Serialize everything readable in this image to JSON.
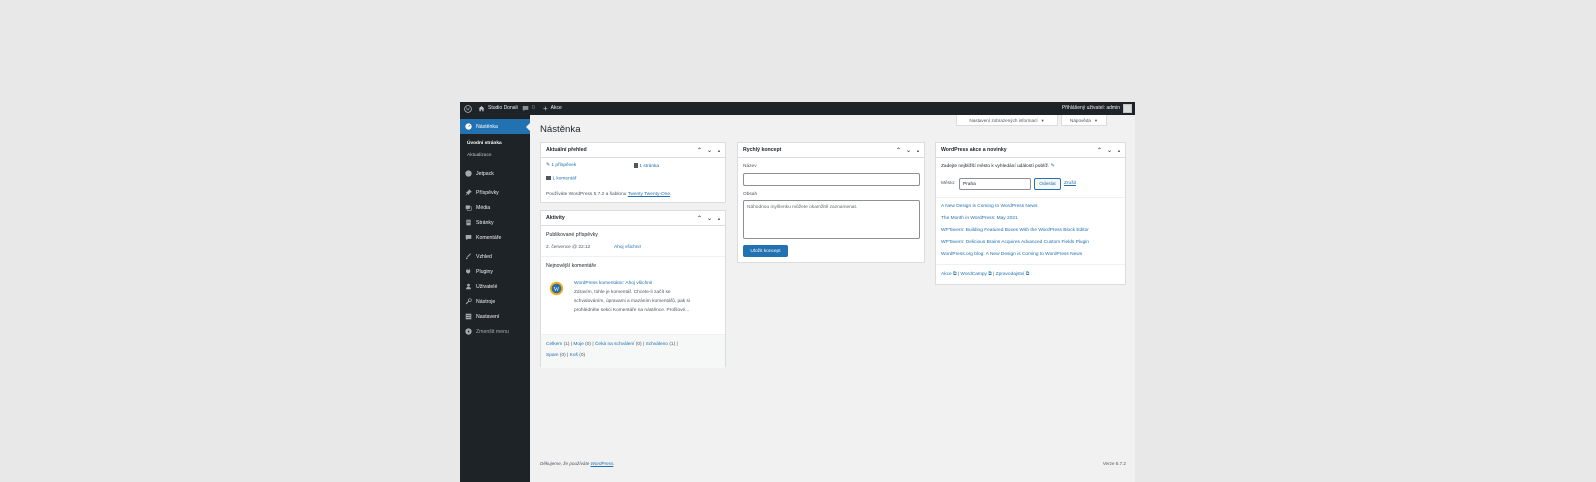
{
  "adminbar": {
    "site_name": "Studio Donali",
    "comments_count": "0",
    "new_label": "Akce",
    "user_greeting": "Přihlášený uživatel: admin"
  },
  "sidebar": {
    "dashboard": "Nástěnka",
    "sub_home": "Úvodní stránka",
    "sub_updates": "Aktualizace",
    "jetpack": "Jetpack",
    "posts": "Příspěvky",
    "media": "Média",
    "pages": "Stránky",
    "comments": "Komentáře",
    "appearance": "Vzhled",
    "plugins": "Pluginy",
    "users": "Uživatelé",
    "tools": "Nástroje",
    "settings": "Nastavení",
    "collapse": "Zmenšit menu"
  },
  "top_buttons": {
    "screen_options": "Nastavení zobrazených informací",
    "help": "Nápověda"
  },
  "page_title": "Nástěnka",
  "glance": {
    "title": "Aktuální přehled",
    "posts": "1 příspěvek",
    "pages": "1 stránka",
    "comments": "1 komentář",
    "info_prefix": "Používáte WordPress 5.7.2 a šablonu",
    "theme_link": "Twenty Twenty-One",
    "info_suffix": "."
  },
  "activity": {
    "title": "Aktivity",
    "published_heading": "Publikované příspěvky",
    "pub_date": "2. července @ 22:12",
    "pub_link": "Ahoj všichni!",
    "recent_comments_heading": "Nejnovější komentáře",
    "comment_from": "WordPress komentátor:",
    "comment_post": "Ahoj všichni!",
    "comment_line1": "Zdravím, tohle je komentář. Chcete-li začít se",
    "comment_line2": "schvalováním, úpravami a mazáním komentářů, pak si",
    "comment_line3": "prohlédněte sekci Komentáře na nástěnce. Profilové...",
    "filter_all": "Celkem",
    "filter_all_count": "(1)",
    "filter_mine": "Moje",
    "filter_mine_count": "(0)",
    "filter_pending": "Čeká na schválení",
    "filter_pending_count": "(0)",
    "filter_approved": "Schváleno",
    "filter_approved_count": "(1)",
    "filter_spam": "Spam",
    "filter_spam_count": "(0)",
    "filter_trash": "Koš",
    "filter_trash_count": "(0)"
  },
  "quick_draft": {
    "title": "Rychlý koncept",
    "name_label": "Název",
    "content_label": "Obsah",
    "content_placeholder": "Náhodnou myšlenku můžete okamžitě zaznamenat.",
    "save_button": "Uložit koncept"
  },
  "events": {
    "title": "WordPress akce a novinky",
    "prompt": "Zadejte nejbližší město k vyhledání událostí poblíž.",
    "city_label": "Město:",
    "city_value": "Praha",
    "submit": "Odeslat",
    "cancel": "Zrušit",
    "news": [
      "A New Design is Coming to WordPress News",
      "The Month in WordPress: May 2021",
      "WPTavern: Building Featured Boxes With the WordPress Block Editor",
      "WPTavern: Delicious Brains Acquires Advanced Custom Fields Plugin",
      "WordPress.org blog: A New Design is Coming to WordPress News"
    ],
    "link_meetups": "Akce",
    "link_wordcamps": "WordCampy",
    "link_news": "Zpravodajství"
  },
  "footer": {
    "thanks_prefix": "Děkujeme, že používáte",
    "thanks_link": "WordPress",
    "thanks_suffix": ".",
    "version": "Verze 5.7.2"
  },
  "colors": {
    "adminbar_bg": "#1d2327",
    "accent": "#2271b1",
    "page_bg": "#f1f1f1"
  }
}
